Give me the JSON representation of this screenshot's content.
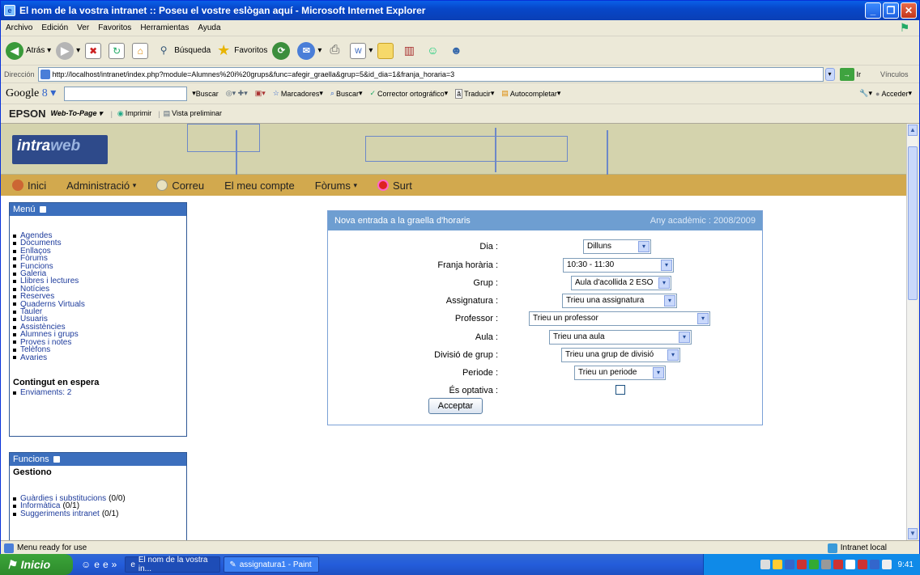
{
  "window": {
    "title": "El nom de la vostra intranet :: Poseu el vostre eslògan aquí - Microsoft Internet Explorer"
  },
  "menubar": [
    "Archivo",
    "Edición",
    "Ver",
    "Favoritos",
    "Herramientas",
    "Ayuda"
  ],
  "toolbar": {
    "back": "Atrás",
    "search": "Búsqueda",
    "favorites": "Favoritos"
  },
  "address": {
    "label": "Dirección",
    "url": "http://localhost/intranet/index.php?module=Alumnes%20i%20grups&func=afegir_graella&grup=5&id_dia=1&franja_horaria=3",
    "go": "Ir",
    "links": "Vínculos"
  },
  "googlebar": {
    "logo": "Google",
    "search": "Buscar",
    "bookmarks": "Marcadores",
    "find": "Buscar",
    "spell": "Corrector ortográfico",
    "translate": "Traducir",
    "autofill": "Autocompletar",
    "signin": "Acceder"
  },
  "epsonbar": {
    "brand": "EPSON",
    "webtopage": "Web-To-Page",
    "print": "Imprimir",
    "preview": "Vista preliminar"
  },
  "nav": [
    "Inici",
    "Administració",
    "Correu",
    "El meu compte",
    "Fòrums",
    "Surt"
  ],
  "menu": {
    "title": "Menú",
    "items": [
      "Agendes",
      "Documents",
      "Enllaços",
      "Fòrums",
      "Funcions",
      "Galeria",
      "Llibres i lectures",
      "Notícies",
      "Reserves",
      "Quaderns Virtuals",
      "Tauler",
      "Usuaris",
      "Assistències",
      "Alumnes i grups",
      "Proves i notes",
      "Telèfons",
      "Avaries"
    ],
    "waiting_title": "Contingut en espera",
    "waiting_item": "Enviaments: 2"
  },
  "funcions": {
    "title": "Funcions",
    "subtitle": "Gestiono",
    "items": [
      {
        "label": "Guàrdies i substitucions",
        "count": "(0/0)"
      },
      {
        "label": "Informàtica",
        "count": "(0/1)"
      },
      {
        "label": "Suggeriments intranet",
        "count": "(0/1)"
      }
    ]
  },
  "form": {
    "title": "Nova entrada a la graella d'horaris",
    "year": "Any acadèmic : 2008/2009",
    "fields": [
      {
        "label": "Dia :",
        "value": "Dilluns"
      },
      {
        "label": "Franja horària :",
        "value": "10:30 - 11:30"
      },
      {
        "label": "Grup :",
        "value": "Aula d'acollida 2 ESO"
      },
      {
        "label": "Assignatura :",
        "value": "Trieu una assignatura"
      },
      {
        "label": "Professor :",
        "value": "Trieu un professor"
      },
      {
        "label": "Aula :",
        "value": "Trieu una aula"
      },
      {
        "label": "Divisió de grup :",
        "value": "Trieu una grup de divisió"
      },
      {
        "label": "Periode :",
        "value": "Trieu un periode"
      },
      {
        "label": "És optativa :",
        "checked": false
      }
    ],
    "submit": "Acceptar"
  },
  "statusbar": {
    "text": "Menu ready for use",
    "zone": "Intranet local"
  },
  "taskbar": {
    "start": "Inicio",
    "tasks": [
      "El nom de la vostra in...",
      "assignatura1 - Paint"
    ],
    "clock": "9:41"
  }
}
